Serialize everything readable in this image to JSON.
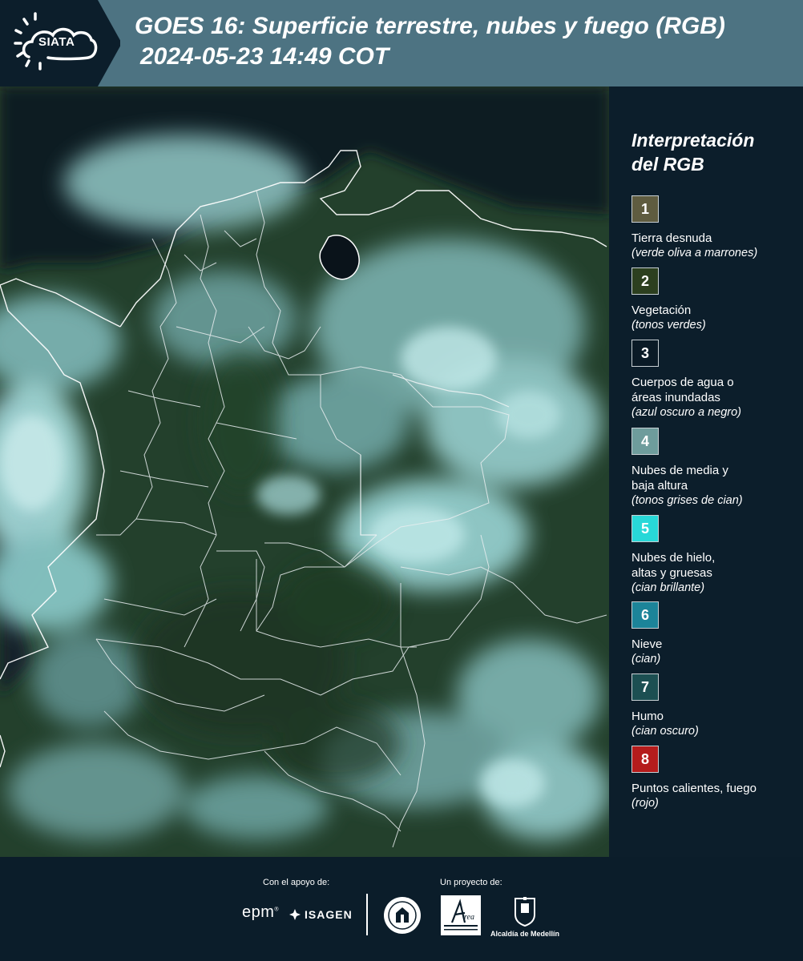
{
  "header": {
    "logo_text": "SIATA",
    "title_line1": "GOES 16: Superficie terrestre, nubes y fuego (RGB)",
    "title_line2": "2024-05-23 14:49 COT",
    "background_color": "#4d7382"
  },
  "map": {
    "description_icon": "satellite-rgb-map"
  },
  "legend": {
    "title_line1": "Interpretación",
    "title_line2": "del RGB",
    "items": [
      {
        "number": "1",
        "color": "#5f5c40",
        "lines": [
          "Tierra desnuda"
        ],
        "desc": "(verde oliva a marrones)"
      },
      {
        "number": "2",
        "color": "#2c3f1f",
        "lines": [
          "Vegetación"
        ],
        "desc": "(tonos verdes)"
      },
      {
        "number": "3",
        "color": "#0a1a26",
        "lines": [
          "Cuerpos de agua o",
          "áreas inundadas"
        ],
        "desc": "(azul oscuro a negro)"
      },
      {
        "number": "4",
        "color": "#6e9c9c",
        "lines": [
          "Nubes de media y",
          "baja altura"
        ],
        "desc": "(tonos grises de cian)"
      },
      {
        "number": "5",
        "color": "#28d8d8",
        "lines": [
          "Nubes de hielo,",
          "altas y gruesas"
        ],
        "desc": "(cian brillante)"
      },
      {
        "number": "6",
        "color": "#1c8499",
        "lines": [
          "Nieve"
        ],
        "desc": "(cian)"
      },
      {
        "number": "7",
        "color": "#1c4f52",
        "lines": [
          "Humo"
        ],
        "desc": "(cian oscuro)"
      },
      {
        "number": "8",
        "color": "#b51c1c",
        "lines": [
          "Puntos calientes, fuego"
        ],
        "desc": "(rojo)"
      }
    ]
  },
  "footer": {
    "support_label": "Con el apoyo de:",
    "project_label": "Un proyecto de:",
    "epm_logo": "epm",
    "isagen_logo": "ISAGEN",
    "alcaldia_logo": "Alcaldía de Medellín"
  }
}
